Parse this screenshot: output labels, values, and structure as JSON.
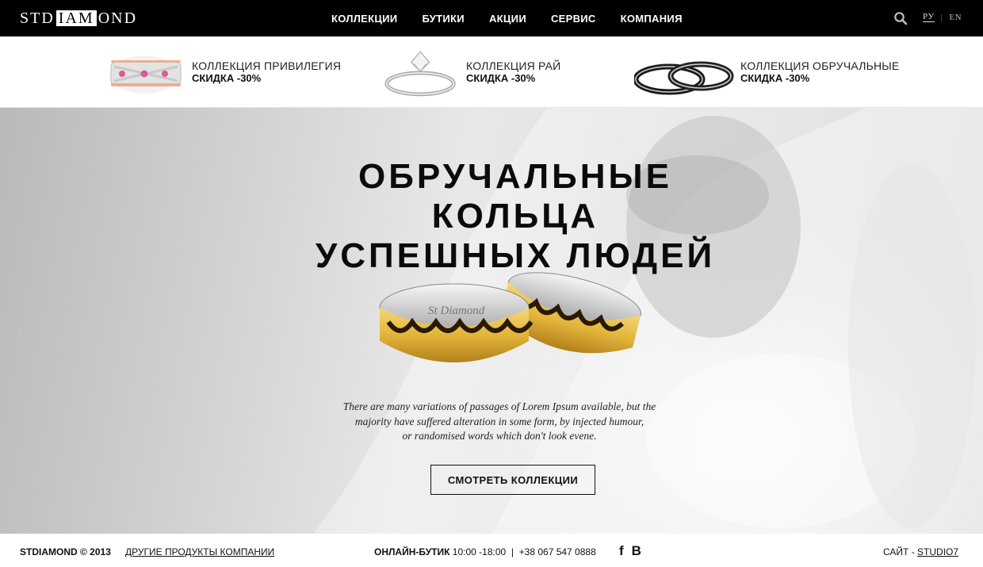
{
  "header": {
    "logo": {
      "part1": "STD",
      "part2": "IAM",
      "part3": "OND"
    },
    "nav": [
      "КОЛЛЕКЦИИ",
      "БУТИКИ",
      "АКЦИИ",
      "СЕРВИС",
      "КОМПАНИЯ"
    ],
    "lang": {
      "active": "РУ",
      "separator": "|",
      "other": "EN"
    }
  },
  "promos": [
    {
      "title": "КОЛЛЕКЦИЯ ПРИВИЛЕГИЯ",
      "discount": "СКИДКА -30%"
    },
    {
      "title": "КОЛЛЕКЦИЯ РАЙ",
      "discount": "СКИДКА -30%"
    },
    {
      "title": "КОЛЛЕКЦИЯ ОБРУЧАЛЬНЫЕ",
      "discount": "СКИДКА -30%"
    }
  ],
  "hero": {
    "headline": [
      "ОБРУЧАЛЬНЫЕ",
      "КОЛЬЦА",
      "УСПЕШНЫХ ЛЮДЕЙ"
    ],
    "ring_engraving": "St Diamond",
    "lead": [
      "There are many variations of passages of Lorem Ipsum available, but the",
      "majority have suffered alteration in some form, by injected humour,",
      "or randomised words which don't look evene."
    ],
    "cta": "СМОТРЕТЬ КОЛЛЕКЦИИ"
  },
  "footer": {
    "copyright": "STDIAMOND © 2013",
    "other_products": "ДРУГИЕ ПРОДУКТЫ КОМПАНИИ",
    "shop_label": "ОНЛАЙН-БУТИК",
    "shop_hours": "10:00 -18:00",
    "shop_sep": "|",
    "shop_phone": "+38 067 547 0888",
    "social": [
      "f",
      "В"
    ],
    "site_label": "САЙТ -",
    "site_link": "STUDIO7"
  },
  "colors": {
    "topbar": "#000000",
    "gold": "#e2b53a",
    "text": "#111111"
  }
}
